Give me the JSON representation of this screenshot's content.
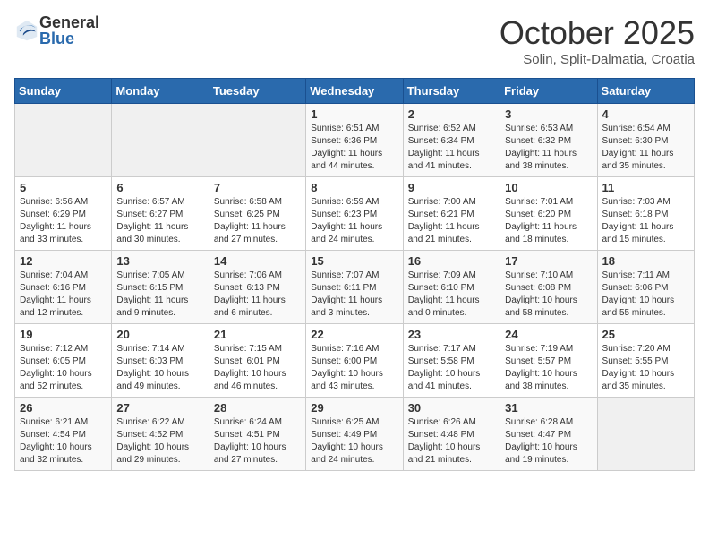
{
  "header": {
    "logo_general": "General",
    "logo_blue": "Blue",
    "month_title": "October 2025",
    "subtitle": "Solin, Split-Dalmatia, Croatia"
  },
  "days_of_week": [
    "Sunday",
    "Monday",
    "Tuesday",
    "Wednesday",
    "Thursday",
    "Friday",
    "Saturday"
  ],
  "weeks": [
    [
      {
        "day": "",
        "info": ""
      },
      {
        "day": "",
        "info": ""
      },
      {
        "day": "",
        "info": ""
      },
      {
        "day": "1",
        "info": "Sunrise: 6:51 AM\nSunset: 6:36 PM\nDaylight: 11 hours and 44 minutes."
      },
      {
        "day": "2",
        "info": "Sunrise: 6:52 AM\nSunset: 6:34 PM\nDaylight: 11 hours and 41 minutes."
      },
      {
        "day": "3",
        "info": "Sunrise: 6:53 AM\nSunset: 6:32 PM\nDaylight: 11 hours and 38 minutes."
      },
      {
        "day": "4",
        "info": "Sunrise: 6:54 AM\nSunset: 6:30 PM\nDaylight: 11 hours and 35 minutes."
      }
    ],
    [
      {
        "day": "5",
        "info": "Sunrise: 6:56 AM\nSunset: 6:29 PM\nDaylight: 11 hours and 33 minutes."
      },
      {
        "day": "6",
        "info": "Sunrise: 6:57 AM\nSunset: 6:27 PM\nDaylight: 11 hours and 30 minutes."
      },
      {
        "day": "7",
        "info": "Sunrise: 6:58 AM\nSunset: 6:25 PM\nDaylight: 11 hours and 27 minutes."
      },
      {
        "day": "8",
        "info": "Sunrise: 6:59 AM\nSunset: 6:23 PM\nDaylight: 11 hours and 24 minutes."
      },
      {
        "day": "9",
        "info": "Sunrise: 7:00 AM\nSunset: 6:21 PM\nDaylight: 11 hours and 21 minutes."
      },
      {
        "day": "10",
        "info": "Sunrise: 7:01 AM\nSunset: 6:20 PM\nDaylight: 11 hours and 18 minutes."
      },
      {
        "day": "11",
        "info": "Sunrise: 7:03 AM\nSunset: 6:18 PM\nDaylight: 11 hours and 15 minutes."
      }
    ],
    [
      {
        "day": "12",
        "info": "Sunrise: 7:04 AM\nSunset: 6:16 PM\nDaylight: 11 hours and 12 minutes."
      },
      {
        "day": "13",
        "info": "Sunrise: 7:05 AM\nSunset: 6:15 PM\nDaylight: 11 hours and 9 minutes."
      },
      {
        "day": "14",
        "info": "Sunrise: 7:06 AM\nSunset: 6:13 PM\nDaylight: 11 hours and 6 minutes."
      },
      {
        "day": "15",
        "info": "Sunrise: 7:07 AM\nSunset: 6:11 PM\nDaylight: 11 hours and 3 minutes."
      },
      {
        "day": "16",
        "info": "Sunrise: 7:09 AM\nSunset: 6:10 PM\nDaylight: 11 hours and 0 minutes."
      },
      {
        "day": "17",
        "info": "Sunrise: 7:10 AM\nSunset: 6:08 PM\nDaylight: 10 hours and 58 minutes."
      },
      {
        "day": "18",
        "info": "Sunrise: 7:11 AM\nSunset: 6:06 PM\nDaylight: 10 hours and 55 minutes."
      }
    ],
    [
      {
        "day": "19",
        "info": "Sunrise: 7:12 AM\nSunset: 6:05 PM\nDaylight: 10 hours and 52 minutes."
      },
      {
        "day": "20",
        "info": "Sunrise: 7:14 AM\nSunset: 6:03 PM\nDaylight: 10 hours and 49 minutes."
      },
      {
        "day": "21",
        "info": "Sunrise: 7:15 AM\nSunset: 6:01 PM\nDaylight: 10 hours and 46 minutes."
      },
      {
        "day": "22",
        "info": "Sunrise: 7:16 AM\nSunset: 6:00 PM\nDaylight: 10 hours and 43 minutes."
      },
      {
        "day": "23",
        "info": "Sunrise: 7:17 AM\nSunset: 5:58 PM\nDaylight: 10 hours and 41 minutes."
      },
      {
        "day": "24",
        "info": "Sunrise: 7:19 AM\nSunset: 5:57 PM\nDaylight: 10 hours and 38 minutes."
      },
      {
        "day": "25",
        "info": "Sunrise: 7:20 AM\nSunset: 5:55 PM\nDaylight: 10 hours and 35 minutes."
      }
    ],
    [
      {
        "day": "26",
        "info": "Sunrise: 6:21 AM\nSunset: 4:54 PM\nDaylight: 10 hours and 32 minutes."
      },
      {
        "day": "27",
        "info": "Sunrise: 6:22 AM\nSunset: 4:52 PM\nDaylight: 10 hours and 29 minutes."
      },
      {
        "day": "28",
        "info": "Sunrise: 6:24 AM\nSunset: 4:51 PM\nDaylight: 10 hours and 27 minutes."
      },
      {
        "day": "29",
        "info": "Sunrise: 6:25 AM\nSunset: 4:49 PM\nDaylight: 10 hours and 24 minutes."
      },
      {
        "day": "30",
        "info": "Sunrise: 6:26 AM\nSunset: 4:48 PM\nDaylight: 10 hours and 21 minutes."
      },
      {
        "day": "31",
        "info": "Sunrise: 6:28 AM\nSunset: 4:47 PM\nDaylight: 10 hours and 19 minutes."
      },
      {
        "day": "",
        "info": ""
      }
    ]
  ]
}
